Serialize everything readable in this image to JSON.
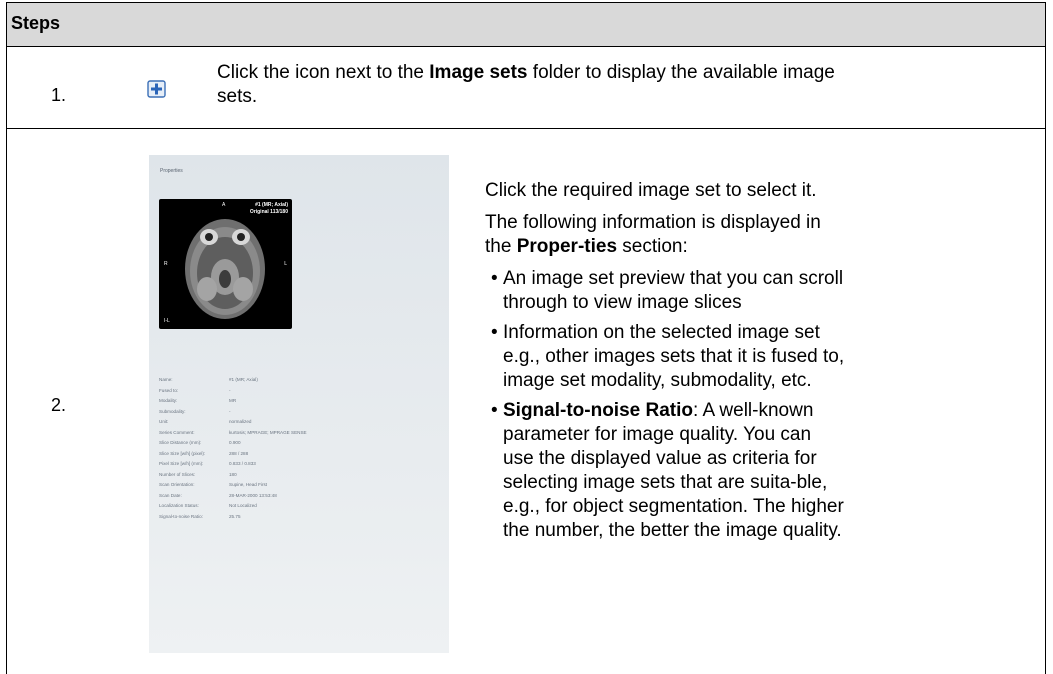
{
  "header": {
    "label": "Steps"
  },
  "step1": {
    "number": "1.",
    "icon": "plus-box-icon",
    "text_before": "Click the icon next to the ",
    "text_bold": "Image sets",
    "text_after": " folder to display the available image sets."
  },
  "step2": {
    "number": "2.",
    "screenshot": {
      "title": "Properties",
      "preview": {
        "orientation_top": "A",
        "header_line1": "#1 (MR; Axial)",
        "header_line2": "Original 113/180",
        "orientation_left": "R",
        "orientation_right": "L",
        "corner_label": "I-L"
      },
      "properties": [
        {
          "key": "Name:",
          "value": "#1 (MR; Axial)"
        },
        {
          "key": "Fused to:",
          "value": "-"
        },
        {
          "key": "Modality:",
          "value": "MR"
        },
        {
          "key": "Submodality:",
          "value": "-"
        },
        {
          "key": "Unit:",
          "value": "normalized"
        },
        {
          "key": "Series Comment:",
          "value": "kurtosis; MPRAGE; MPRAGE SENSE"
        },
        {
          "key": "Slice Distance (mm):",
          "value": "0.900"
        },
        {
          "key": "Slice Size [w/h] (pixel):",
          "value": "288 / 288"
        },
        {
          "key": "Pixel Size [w/h] (mm):",
          "value": "0.833 / 0.833"
        },
        {
          "key": "Number of Slices:",
          "value": "180"
        },
        {
          "key": "Scan Orientation:",
          "value": "Supine, Head First"
        },
        {
          "key": "Scan Date:",
          "value": "28-MAR-2000 13:53:48"
        },
        {
          "key": "Localization Status:",
          "value": "Not Localized"
        },
        {
          "key": "Signal-to-noise Ratio:",
          "value": "25.75"
        }
      ]
    },
    "para1": "Click the required image set to select it.",
    "para2_before": "The following information is displayed in the ",
    "para2_bold": "Proper-ties",
    "para2_after": " section:",
    "bullets": [
      {
        "bold": "",
        "text": "An image set preview that you can scroll through to view image slices"
      },
      {
        "bold": "",
        "text": "Information on the selected image set e.g., other images sets that it is fused to, image set modality, submodality, etc."
      },
      {
        "bold": "Signal-to-noise Ratio",
        "text": ": A well-known parameter for image quality. You can use the displayed value as criteria for selecting image sets that are suita-ble, e.g., for object segmentation. The higher the number, the better the image quality."
      }
    ]
  }
}
